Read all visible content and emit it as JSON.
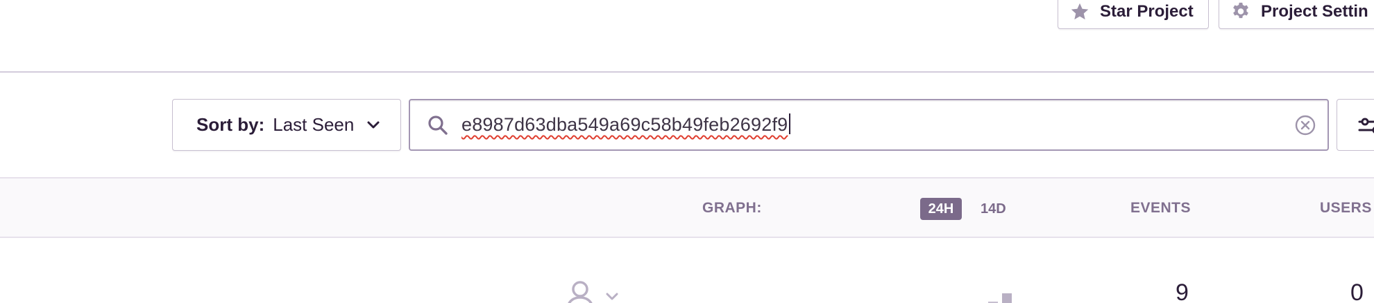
{
  "header": {
    "star_label": "Star Project",
    "settings_label": "Project Settin"
  },
  "toolbar": {
    "sort_prefix": "Sort by:",
    "sort_value": "Last Seen",
    "search_value": "e8987d63dba549a69c58b49feb2692f9"
  },
  "list_header": {
    "graph_label": "GRAPH:",
    "period_options": [
      "24H",
      "14D"
    ],
    "selected_period": "24H",
    "events_label": "EVENTS",
    "users_label": "USERS"
  },
  "issue_row": {
    "events": "9",
    "users": "0"
  },
  "colors": {
    "accent": "#7b6a8a",
    "border": "#c6becf",
    "text": "#2b1d38",
    "muted": "#80708f"
  }
}
